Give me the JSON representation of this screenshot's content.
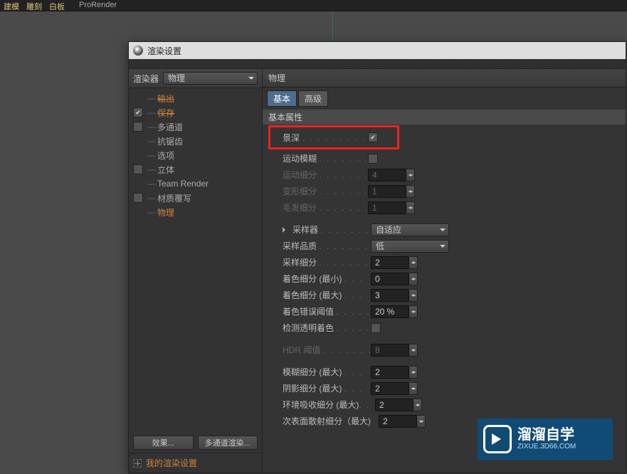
{
  "topbar": {
    "item1": "建模",
    "item2": "雕刻",
    "item3": "白板",
    "item4": "ProRender"
  },
  "dialog": {
    "title": "渲染设置"
  },
  "renderer": {
    "label": "渲染器",
    "value": "物理"
  },
  "opts": {
    "output": "输出",
    "save": "保存",
    "multipass": "多通道",
    "antialias": "抗锯齿",
    "options": "选项",
    "stereo": "立体",
    "teamrender": "Team Render",
    "override": "材质覆写",
    "physical": "物理"
  },
  "buttons": {
    "effects": "效果...",
    "multirender": "多通道渲染..."
  },
  "mysettings": "我的渲染设置",
  "panel": {
    "title": "物理",
    "tab_basic": "基本",
    "tab_adv": "高级",
    "group": "基本属性",
    "dof": "景深",
    "motionblur": "运动模糊",
    "motion_sub": {
      "label": "运动细分",
      "value": "4"
    },
    "deform_sub": {
      "label": "变形细分",
      "value": "1"
    },
    "hair_sub": {
      "label": "毛发细分",
      "value": "1"
    },
    "sampler": {
      "label": "采样器",
      "value": "自适应"
    },
    "quality": {
      "label": "采样品质",
      "value": "低"
    },
    "samp_sub": {
      "label": "采样细分",
      "value": "2"
    },
    "shade_min": {
      "label": "着色细分 (最小)",
      "value": "0"
    },
    "shade_max": {
      "label": "着色细分 (最大)",
      "value": "3"
    },
    "shade_err": {
      "label": "着色错误阈值",
      "value": "20 %"
    },
    "detect": {
      "label": "检测透明着色"
    },
    "hdr": {
      "label": "HDR 阈值",
      "value": "8"
    },
    "blur_max": {
      "label": "模糊细分 (最大)",
      "value": "2"
    },
    "shadow_max": {
      "label": "阴影细分 (最大)",
      "value": "2"
    },
    "ao_max": {
      "label": "环境吸收细分 (最大)",
      "value": "2"
    },
    "sss_max": {
      "label": "次表面散射细分（最大)",
      "value": "2"
    }
  },
  "watermark": {
    "line1": "溜溜自学",
    "line2": "ZIXUE.3D66.COM"
  }
}
